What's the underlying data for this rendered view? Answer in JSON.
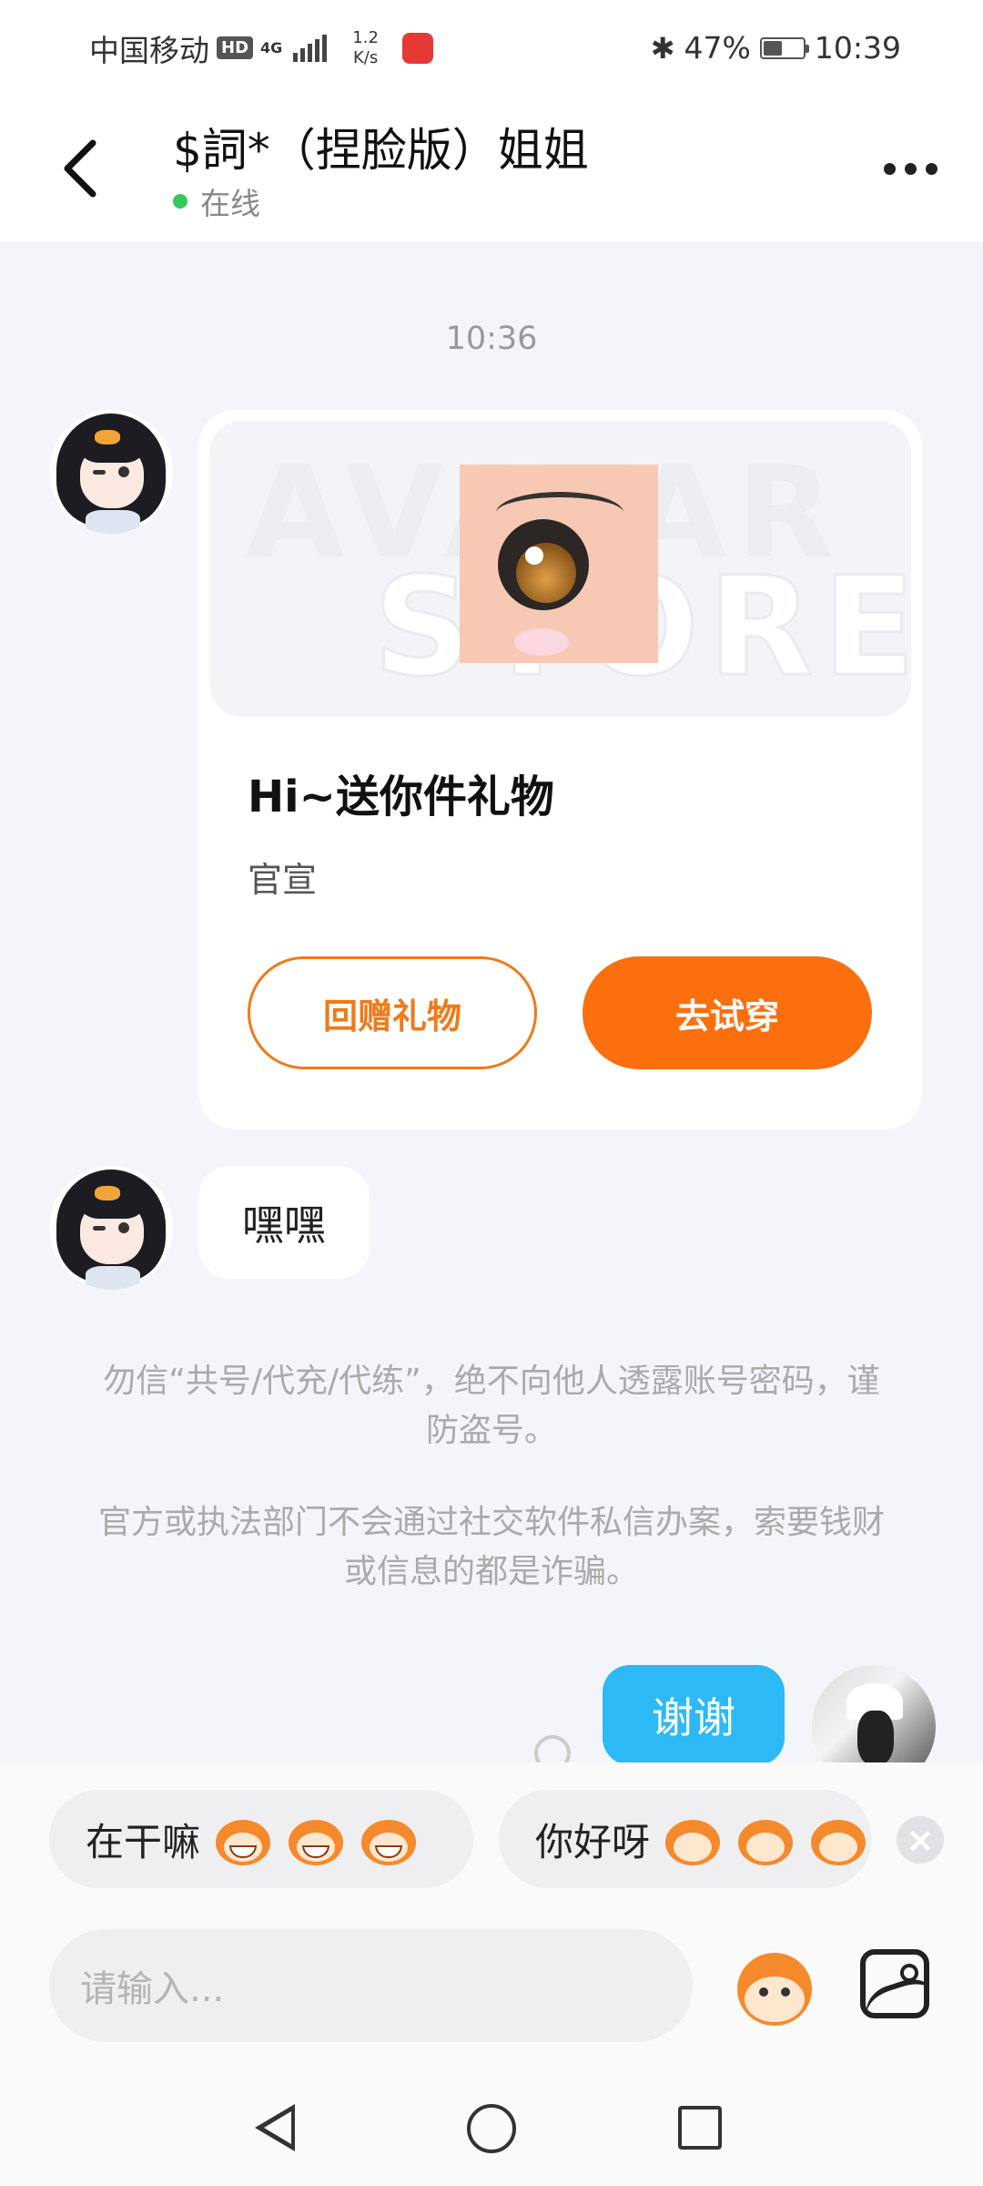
{
  "status_bar": {
    "carrier": "中国移动",
    "hd_badge": "HD",
    "net_type": "4G",
    "speed_value": "1.2",
    "speed_unit": "K/s",
    "battery_percent": "47%",
    "battery_level": 0.47,
    "time": "10:39"
  },
  "header": {
    "title": "$詞*（捏脸版）姐姐",
    "status": "在线"
  },
  "chat": {
    "timestamp": "10:36",
    "gift_card": {
      "watermark_line1": "AVATAR",
      "watermark_line2": "STORE",
      "title": "Hi~送你件礼物",
      "subtitle": "官宣",
      "return_gift_label": "回赠礼物",
      "try_on_label": "去试穿"
    },
    "incoming_message": "嘿嘿",
    "notice_1": "勿信“共号/代充/代练”，绝不向他人透露账号密码，谨防盗号。",
    "notice_2": "官方或执法部门不会通过社交软件私信办案，索要钱财或信息的都是诈骗。",
    "outgoing_message": "谢谢"
  },
  "quick_replies": [
    {
      "text": "在干嘛",
      "emoji_count": 3
    },
    {
      "text": "你好呀",
      "emoji_count": 3
    }
  ],
  "composer": {
    "placeholder": "请输入..."
  },
  "colors": {
    "accent_orange": "#fb6f0f",
    "outgoing_bubble": "#2db9f6",
    "online_dot": "#35c759"
  }
}
